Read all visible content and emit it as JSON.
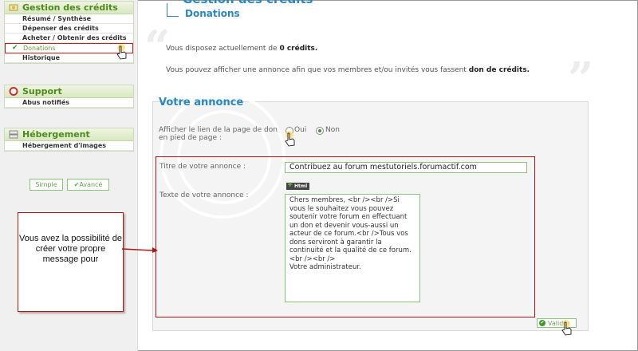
{
  "sidebar": {
    "credits": {
      "title": "Gestion des crédits",
      "items": [
        "Résumé / Synthèse",
        "Dépenser des crédits",
        "Acheter / Obtenir des crédits",
        "Donations",
        "Historique"
      ]
    },
    "support": {
      "title": "Support",
      "items": [
        "Abus notifiés"
      ]
    },
    "hosting": {
      "title": "Hébergement",
      "items": [
        "Hébergement d'images"
      ]
    },
    "mode_simple": "Simple",
    "mode_advanced": "Avancé"
  },
  "header": {
    "title": "Gestion des crédits",
    "subtitle": "Donations"
  },
  "info": {
    "line1_prefix": "Vous disposez actuellement de ",
    "line1_value": "0 crédits.",
    "line2_prefix": "Vous pouvez afficher une annonce afin que vos membres et/ou invités vous fassent ",
    "line2_value": "don de crédits."
  },
  "annonce": {
    "title": "Votre annonce",
    "show_link_label_1": "Afficher le lien de la page de don",
    "show_link_label_2": "en pied de page :",
    "option_yes": "Oui",
    "option_no": "Non",
    "selected": "Non",
    "title_label": "Titre de votre annonce :",
    "title_value": "Contribuez au forum mestutoriels.forumactif.com",
    "text_label": "Texte de votre annonce :",
    "html_badge": "Html",
    "text_value": "Chers membres, <br /><br />Si vous le souhaitez vous pouvez soutenir votre forum en effectuant un don et devenir vous-aussi un acteur de ce forum.<br />Tous vos dons serviront à garantir la continuité et la qualité de ce forum. <br /><br />\nVotre administrateur.",
    "submit_label": "Valider"
  },
  "callout": {
    "text": "Vous avez la possibilité de créer votre propre message pour"
  },
  "colors": {
    "accent": "#2a88c0",
    "green": "#4e8a1a",
    "highlight": "#b01818"
  }
}
